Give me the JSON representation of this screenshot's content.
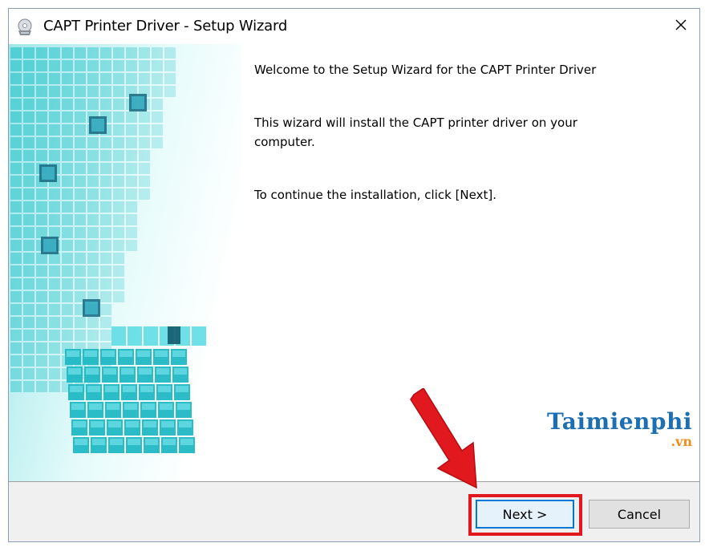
{
  "window": {
    "title": "CAPT Printer Driver - Setup Wizard",
    "close_glyph": "✕"
  },
  "content": {
    "heading": "Welcome to the Setup Wizard for the CAPT Printer Driver",
    "description": "This wizard will install the CAPT printer driver on your computer.",
    "instruction": "To continue the installation, click [Next]."
  },
  "watermark": {
    "main": "Taimienphi",
    "sub": ".vn"
  },
  "buttons": {
    "next_label": "Next >",
    "cancel_label": "Cancel"
  },
  "colors": {
    "accent": "#0078d7",
    "highlight": "#e1181e",
    "cube": "#2ec8d0",
    "logo_blue": "#1d6fb4",
    "logo_orange": "#f08b1d"
  },
  "icons": {
    "title_icon": "printer-disc-icon",
    "close_icon": "close-icon"
  }
}
